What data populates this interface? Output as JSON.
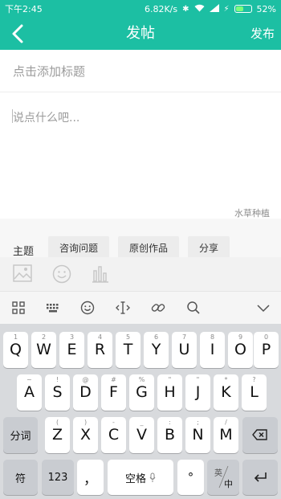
{
  "status_bar": {
    "time": "下午2:45",
    "speed": "6.82K/s",
    "battery": "52%",
    "battery_level": 0.52
  },
  "header": {
    "title": "发帖",
    "publish": "发布"
  },
  "editor": {
    "title_placeholder": "点击添加标题",
    "content_placeholder": "说点什么吧...",
    "category": "水草种植"
  },
  "topics": {
    "label": "主题",
    "chips": [
      "咨询问题",
      "原创作品",
      "分享"
    ]
  },
  "media_icons": [
    "image-icon",
    "emoji-icon",
    "chart-icon"
  ],
  "keyboard_toolbar": [
    "grid-icon",
    "keyboard-icon",
    "emoji-icon",
    "cursor-icon",
    "link-icon",
    "search-icon",
    "collapse-icon"
  ],
  "keyboard": {
    "row1": [
      [
        "1",
        "Q"
      ],
      [
        "2",
        "W"
      ],
      [
        "3",
        "E"
      ],
      [
        "4",
        "R"
      ],
      [
        "5",
        "T"
      ],
      [
        "6",
        "Y"
      ],
      [
        "7",
        "U"
      ],
      [
        "8",
        "I"
      ],
      [
        "9",
        "O"
      ],
      [
        "0",
        "P"
      ]
    ],
    "row2": [
      [
        "~",
        "A"
      ],
      [
        "!",
        "S"
      ],
      [
        "@",
        "D"
      ],
      [
        "#",
        "F"
      ],
      [
        "%",
        "G"
      ],
      [
        "\"",
        "H"
      ],
      [
        "\"",
        "J"
      ],
      [
        "*",
        "K"
      ],
      [
        "?",
        "L"
      ]
    ],
    "row3": [
      [
        "(",
        "Z"
      ],
      [
        ")",
        "X"
      ],
      [
        "-",
        "C"
      ],
      [
        "_",
        "V"
      ],
      [
        ":",
        "B"
      ],
      [
        ";",
        "N"
      ],
      [
        "/",
        "M"
      ]
    ],
    "shift": "分词",
    "symbols": "符",
    "numbers": "123",
    "comma": "，",
    "space": "空格",
    "period": "°",
    "lang_top": "英",
    "lang_bottom": "中"
  }
}
